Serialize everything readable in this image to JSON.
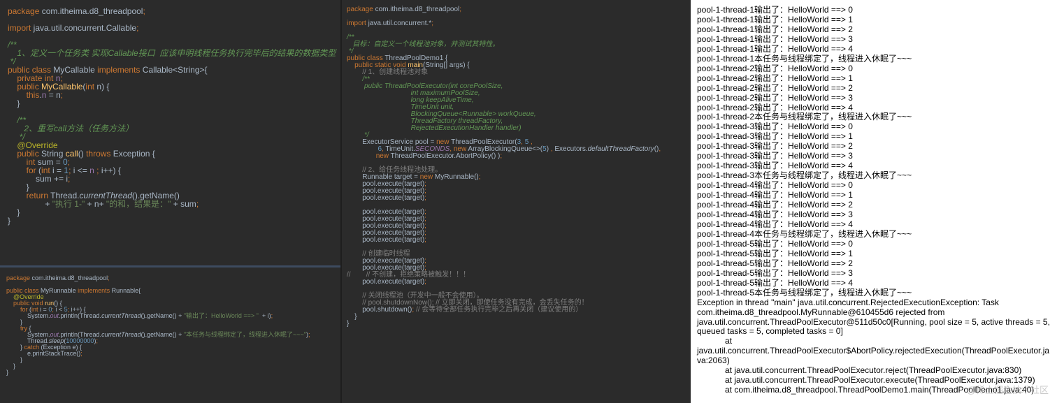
{
  "mycallable": {
    "lines": [
      "package com.itheima.d8_threadpool;",
      "",
      "import java.util.concurrent.Callable;",
      "",
      "/**",
      "    1、定义一个任务类 实现Callable接口  应该申明线程任务执行完毕后的结果的数据类型",
      " */",
      "public class MyCallable implements Callable<String>{",
      "    private int n;",
      "    public MyCallable(int n) {",
      "        this.n = n;",
      "    }",
      "",
      "    /**",
      "       2、重写call方法（任务方法）",
      "     */",
      "    @Override",
      "    public String call() throws Exception {",
      "        int sum = 0;",
      "        for (int i = 1; i <= n ; i++) {",
      "            sum += i;",
      "        }",
      "        return Thread.currentThread().getName()",
      "                + \"执行 1-\" + n+ \"的和，结果是：\" + sum;",
      "    }",
      "}"
    ]
  },
  "myrunnable": {
    "lines": [
      "package com.itheima.d8_threadpool;",
      "",
      "public class MyRunnable implements Runnable{",
      "    @Override",
      "    public void run() {",
      "        for (int i = 0; i < 5; i++) {",
      "            System.out.println(Thread.currentThread().getName() + \"输出了：HelloWorld ==> \"  + i);",
      "        }",
      "        try {",
      "            System.out.println(Thread.currentThread().getName() + \"本任务与线程绑定了，线程进入休眠了~~~\");",
      "            Thread.sleep(10000000);",
      "        } catch (Exception e) {",
      "            e.printStackTrace();",
      "        }",
      "    }",
      "}"
    ]
  },
  "demo": {
    "lines": [
      "package com.itheima.d8_threadpool;",
      "",
      "import java.util.concurrent.*;",
      "",
      "/**",
      "   目标：自定义一个线程池对象，并测试其特性。",
      " */",
      "public class ThreadPoolDemo1 {",
      "    public static void main(String[] args) {",
      "        // 1、创建线程池对象",
      "        /**",
      "         public ThreadPoolExecutor(int corePoolSize,",
      "                                 int maximumPoolSize,",
      "                                 long keepAliveTime,",
      "                                 TimeUnit unit,",
      "                                 BlockingQueue<Runnable> workQueue,",
      "                                 ThreadFactory threadFactory,",
      "                                 RejectedExecutionHandler handler)",
      "         */",
      "        ExecutorService pool = new ThreadPoolExecutor(3, 5 ,",
      "                6, TimeUnit.SECONDS, new ArrayBlockingQueue<>(5) , Executors.defaultThreadFactory(),",
      "               new ThreadPoolExecutor.AbortPolicy() );",
      "",
      "        // 2、给任务线程池处理。",
      "        Runnable target = new MyRunnable();",
      "        pool.execute(target);",
      "        pool.execute(target);",
      "        pool.execute(target);",
      "",
      "        pool.execute(target);",
      "        pool.execute(target);",
      "        pool.execute(target);",
      "        pool.execute(target);",
      "        pool.execute(target);",
      "",
      "        // 创建临时线程",
      "        pool.execute(target);",
      "        pool.execute(target);",
      "//        // 不创建，拒绝策略被触发！！！",
      "        pool.execute(target);",
      "",
      "        // 关闭线程池（开发中一般不会使用）。",
      "        // pool.shutdownNow(); // 立即关闭，即使任务没有完成，会丢失任务的！",
      "        pool.shutdown(); // 会等待全部任务执行完毕之后再关闭（建议使用的）",
      "    }",
      "}"
    ]
  },
  "console": {
    "lines": [
      "pool-1-thread-1输出了：HelloWorld ==> 0",
      "pool-1-thread-1输出了：HelloWorld ==> 1",
      "pool-1-thread-1输出了：HelloWorld ==> 2",
      "pool-1-thread-1输出了：HelloWorld ==> 3",
      "pool-1-thread-1输出了：HelloWorld ==> 4",
      "pool-1-thread-1本任务与线程绑定了，线程进入休眠了~~~",
      "pool-1-thread-2输出了：HelloWorld ==> 0",
      "pool-1-thread-2输出了：HelloWorld ==> 1",
      "pool-1-thread-2输出了：HelloWorld ==> 2",
      "pool-1-thread-2输出了：HelloWorld ==> 3",
      "pool-1-thread-2输出了：HelloWorld ==> 4",
      "pool-1-thread-2本任务与线程绑定了，线程进入休眠了~~~",
      "pool-1-thread-3输出了：HelloWorld ==> 0",
      "pool-1-thread-3输出了：HelloWorld ==> 1",
      "pool-1-thread-3输出了：HelloWorld ==> 2",
      "pool-1-thread-3输出了：HelloWorld ==> 3",
      "pool-1-thread-3输出了：HelloWorld ==> 4",
      "pool-1-thread-3本任务与线程绑定了，线程进入休眠了~~~",
      "pool-1-thread-4输出了：HelloWorld ==> 0",
      "pool-1-thread-4输出了：HelloWorld ==> 1",
      "pool-1-thread-4输出了：HelloWorld ==> 2",
      "pool-1-thread-4输出了：HelloWorld ==> 3",
      "pool-1-thread-4输出了：HelloWorld ==> 4",
      "pool-1-thread-4本任务与线程绑定了，线程进入休眠了~~~",
      "pool-1-thread-5输出了：HelloWorld ==> 0",
      "pool-1-thread-5输出了：HelloWorld ==> 1",
      "pool-1-thread-5输出了：HelloWorld ==> 2",
      "pool-1-thread-5输出了：HelloWorld ==> 3",
      "pool-1-thread-5输出了：HelloWorld ==> 4",
      "pool-1-thread-5本任务与线程绑定了，线程进入休眠了~~~",
      "Exception in thread \"main\" java.util.concurrent.RejectedExecutionException: Task",
      "com.itheima.d8_threadpool.MyRunnable@610455d6 rejected from",
      "java.util.concurrent.ThreadPoolExecutor@511d50c0[Running, pool size = 5, active threads = 5,",
      "queued tasks = 5, completed tasks = 0]",
      "            at",
      "java.util.concurrent.ThreadPoolExecutor$AbortPolicy.rejectedExecution(ThreadPoolExecutor.ja",
      "va:2063)",
      "            at java.util.concurrent.ThreadPoolExecutor.reject(ThreadPoolExecutor.java:830)",
      "            at java.util.concurrent.ThreadPoolExecutor.execute(ThreadPoolExecutor.java:1379)",
      "            at com.itheima.d8_threadpool.ThreadPoolDemo1.main(ThreadPoolDemo1.java:40)"
    ]
  },
  "watermark": "@稀土掘金技术社区"
}
